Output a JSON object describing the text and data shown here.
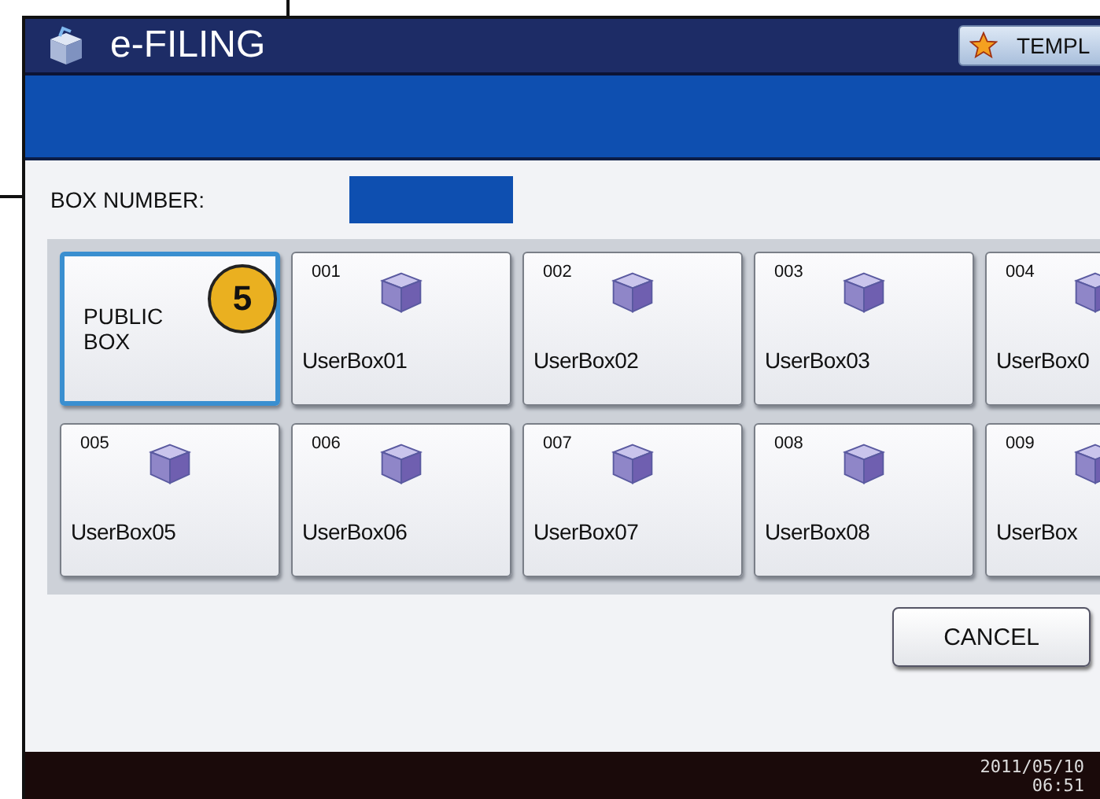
{
  "header": {
    "title": "e-FILING",
    "template_button": "TEMPL"
  },
  "box_number": {
    "label": "BOX NUMBER:"
  },
  "boxes": [
    {
      "kind": "public",
      "label": "PUBLIC BOX",
      "selected": true
    },
    {
      "kind": "user",
      "number": "001",
      "label": "UserBox01",
      "selected": false
    },
    {
      "kind": "user",
      "number": "002",
      "label": "UserBox02",
      "selected": false
    },
    {
      "kind": "user",
      "number": "003",
      "label": "UserBox03",
      "selected": false
    },
    {
      "kind": "user",
      "number": "004",
      "label": "UserBox0",
      "selected": false
    },
    {
      "kind": "user",
      "number": "005",
      "label": "UserBox05",
      "selected": false
    },
    {
      "kind": "user",
      "number": "006",
      "label": "UserBox06",
      "selected": false
    },
    {
      "kind": "user",
      "number": "007",
      "label": "UserBox07",
      "selected": false
    },
    {
      "kind": "user",
      "number": "008",
      "label": "UserBox08",
      "selected": false
    },
    {
      "kind": "user",
      "number": "009",
      "label": "UserBox",
      "selected": false
    }
  ],
  "callout": "5",
  "cancel_button": "CANCEL",
  "status_bar": {
    "date": "2011/05/10",
    "time": "06:51"
  }
}
